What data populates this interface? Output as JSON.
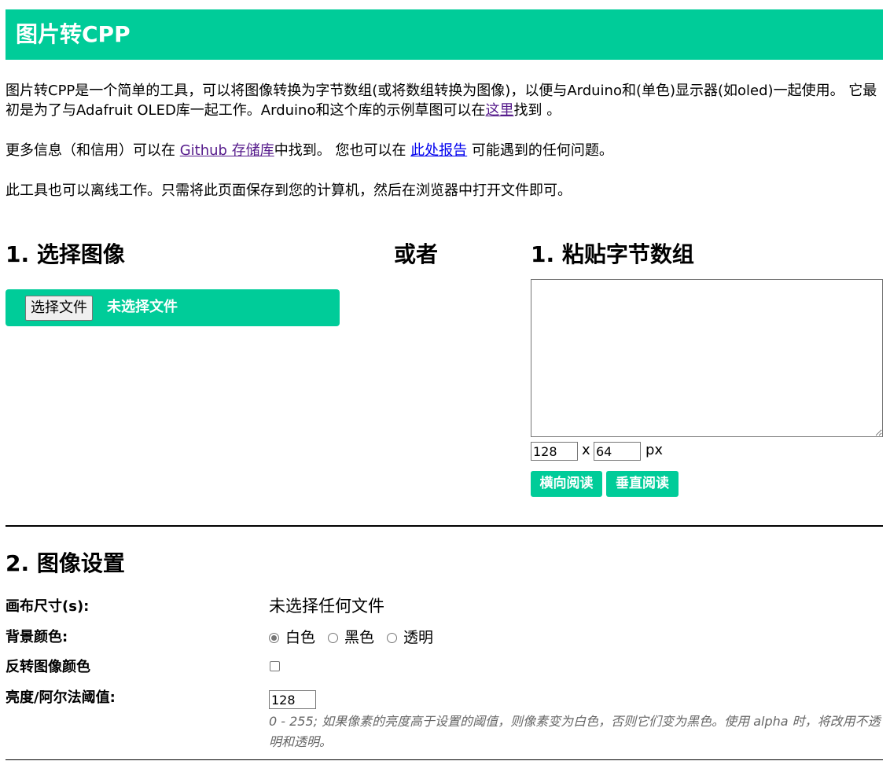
{
  "header": {
    "title": "图片转CPP"
  },
  "intro": {
    "p1_text_a": "图片转CPP是一个简单的工具，可以将图像转换为字节数组(或将数组转换为图像)，以便与Arduino和(单色)显示器(如oled)一起使用。 它最初是为了与Adafruit OLED库一起工作。Arduino和这个库的示例草图可以在",
    "p1_link": "这里",
    "p1_text_b": "找到 。",
    "p2_text_a": "更多信息（和信用）可以在 ",
    "p2_link1": "Github 存储库",
    "p2_text_b": "中找到。 您也可以在 ",
    "p2_link2": "此处报告",
    "p2_text_c": " 可能遇到的任何问题。",
    "p3_text": "此工具也可以离线工作。只需将此页面保存到您的计算机，然后在浏览器中打开文件即可。"
  },
  "step1": {
    "select_title": "1. 选择图像",
    "or_text": "或者",
    "paste_title": "1. 粘贴字节数组",
    "file_button": "选择文件",
    "file_status": "未选择文件",
    "bytes_value": "",
    "width_value": "128",
    "x_text": "x",
    "height_value": "64",
    "px_text": "px",
    "read_horizontal": "横向阅读",
    "read_vertical": "垂直阅读"
  },
  "step2": {
    "title": "2. 图像设置",
    "canvas_label": "画布尺寸(s):",
    "canvas_value": "未选择任何文件",
    "bg_label": "背景颜色:",
    "bg_options": [
      "白色",
      "黑色",
      "透明"
    ],
    "bg_selected": "白色",
    "invert_label": "反转图像颜色",
    "invert_checked": false,
    "threshold_label": "亮度/阿尔法阈值:",
    "threshold_value": "128",
    "threshold_hint": "0 - 255; 如果像素的亮度高于设置的阈值，则像素变为白色，否则它们变为黑色。使用 alpha 时，将改用不透明和透明。"
  },
  "colors": {
    "accent": "#00cc99",
    "visited_link": "#551a8b",
    "link": "#0000ee",
    "hint_text": "#666666"
  }
}
